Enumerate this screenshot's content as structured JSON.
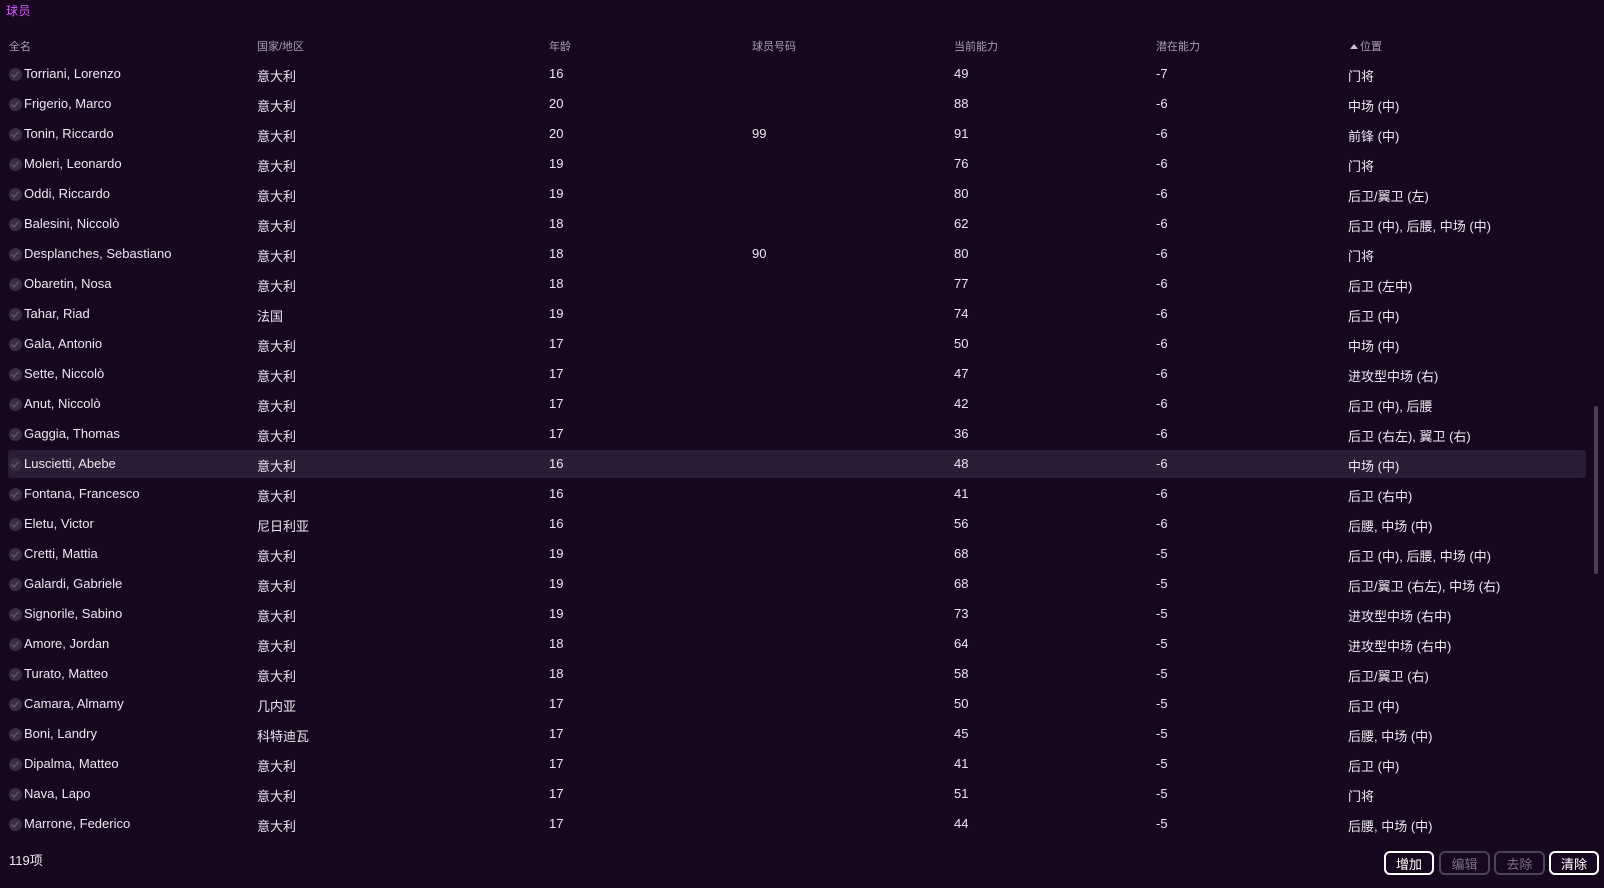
{
  "panel": {
    "title": "球员"
  },
  "columns": {
    "name": "全名",
    "nation": "国家/地区",
    "age": "年龄",
    "number": "球员号码",
    "current_ability": "当前能力",
    "potential_ability": "潜在能力",
    "position": "位置"
  },
  "sort": {
    "column": "position",
    "direction": "ascending"
  },
  "players": [
    {
      "name": "Torriani, Lorenzo",
      "nation": "意大利",
      "age": "16",
      "number": "",
      "ca": "49",
      "pa": "-7",
      "position": "门将"
    },
    {
      "name": "Frigerio, Marco",
      "nation": "意大利",
      "age": "20",
      "number": "",
      "ca": "88",
      "pa": "-6",
      "position": "中场 (中)"
    },
    {
      "name": "Tonin, Riccardo",
      "nation": "意大利",
      "age": "20",
      "number": "99",
      "ca": "91",
      "pa": "-6",
      "position": "前锋 (中)"
    },
    {
      "name": "Moleri, Leonardo",
      "nation": "意大利",
      "age": "19",
      "number": "",
      "ca": "76",
      "pa": "-6",
      "position": "门将"
    },
    {
      "name": "Oddi, Riccardo",
      "nation": "意大利",
      "age": "19",
      "number": "",
      "ca": "80",
      "pa": "-6",
      "position": "后卫/翼卫 (左)"
    },
    {
      "name": "Balesini, Niccolò",
      "nation": "意大利",
      "age": "18",
      "number": "",
      "ca": "62",
      "pa": "-6",
      "position": "后卫 (中), 后腰, 中场 (中)"
    },
    {
      "name": "Desplanches, Sebastiano",
      "nation": "意大利",
      "age": "18",
      "number": "90",
      "ca": "80",
      "pa": "-6",
      "position": "门将"
    },
    {
      "name": "Obaretin, Nosa",
      "nation": "意大利",
      "age": "18",
      "number": "",
      "ca": "77",
      "pa": "-6",
      "position": "后卫 (左中)"
    },
    {
      "name": "Tahar, Riad",
      "nation": "法国",
      "age": "19",
      "number": "",
      "ca": "74",
      "pa": "-6",
      "position": "后卫 (中)"
    },
    {
      "name": "Gala, Antonio",
      "nation": "意大利",
      "age": "17",
      "number": "",
      "ca": "50",
      "pa": "-6",
      "position": "中场 (中)"
    },
    {
      "name": "Sette, Niccolò",
      "nation": "意大利",
      "age": "17",
      "number": "",
      "ca": "47",
      "pa": "-6",
      "position": "进攻型中场 (右)"
    },
    {
      "name": "Anut, Niccolò",
      "nation": "意大利",
      "age": "17",
      "number": "",
      "ca": "42",
      "pa": "-6",
      "position": "后卫 (中), 后腰"
    },
    {
      "name": "Gaggia, Thomas",
      "nation": "意大利",
      "age": "17",
      "number": "",
      "ca": "36",
      "pa": "-6",
      "position": "后卫 (右左), 翼卫 (右)"
    },
    {
      "name": "Luscietti, Abebe",
      "nation": "意大利",
      "age": "16",
      "number": "",
      "ca": "48",
      "pa": "-6",
      "position": "中场 (中)",
      "selected": true
    },
    {
      "name": "Fontana, Francesco",
      "nation": "意大利",
      "age": "16",
      "number": "",
      "ca": "41",
      "pa": "-6",
      "position": "后卫 (右中)"
    },
    {
      "name": "Eletu, Victor",
      "nation": "尼日利亚",
      "age": "16",
      "number": "",
      "ca": "56",
      "pa": "-6",
      "position": "后腰, 中场 (中)"
    },
    {
      "name": "Cretti, Mattia",
      "nation": "意大利",
      "age": "19",
      "number": "",
      "ca": "68",
      "pa": "-5",
      "position": "后卫 (中), 后腰, 中场 (中)"
    },
    {
      "name": "Galardi, Gabriele",
      "nation": "意大利",
      "age": "19",
      "number": "",
      "ca": "68",
      "pa": "-5",
      "position": "后卫/翼卫 (右左), 中场 (右)"
    },
    {
      "name": "Signorile, Sabino",
      "nation": "意大利",
      "age": "19",
      "number": "",
      "ca": "73",
      "pa": "-5",
      "position": "进攻型中场 (右中)"
    },
    {
      "name": "Amore, Jordan",
      "nation": "意大利",
      "age": "18",
      "number": "",
      "ca": "64",
      "pa": "-5",
      "position": "进攻型中场 (右中)"
    },
    {
      "name": "Turato, Matteo",
      "nation": "意大利",
      "age": "18",
      "number": "",
      "ca": "58",
      "pa": "-5",
      "position": "后卫/翼卫 (右)"
    },
    {
      "name": "Camara, Almamy",
      "nation": "几内亚",
      "age": "17",
      "number": "",
      "ca": "50",
      "pa": "-5",
      "position": "后卫 (中)"
    },
    {
      "name": "Boni, Landry",
      "nation": "科特迪瓦",
      "age": "17",
      "number": "",
      "ca": "45",
      "pa": "-5",
      "position": "后腰, 中场 (中)"
    },
    {
      "name": "Dipalma, Matteo",
      "nation": "意大利",
      "age": "17",
      "number": "",
      "ca": "41",
      "pa": "-5",
      "position": "后卫 (中)"
    },
    {
      "name": "Nava, Lapo",
      "nation": "意大利",
      "age": "17",
      "number": "",
      "ca": "51",
      "pa": "-5",
      "position": "门将"
    },
    {
      "name": "Marrone, Federico",
      "nation": "意大利",
      "age": "17",
      "number": "",
      "ca": "44",
      "pa": "-5",
      "position": "后腰, 中场 (中)"
    }
  ],
  "footer": {
    "count": "119项",
    "add_label": "增加",
    "edit_label": "编辑",
    "remove_label": "去除",
    "clear_label": "清除"
  }
}
